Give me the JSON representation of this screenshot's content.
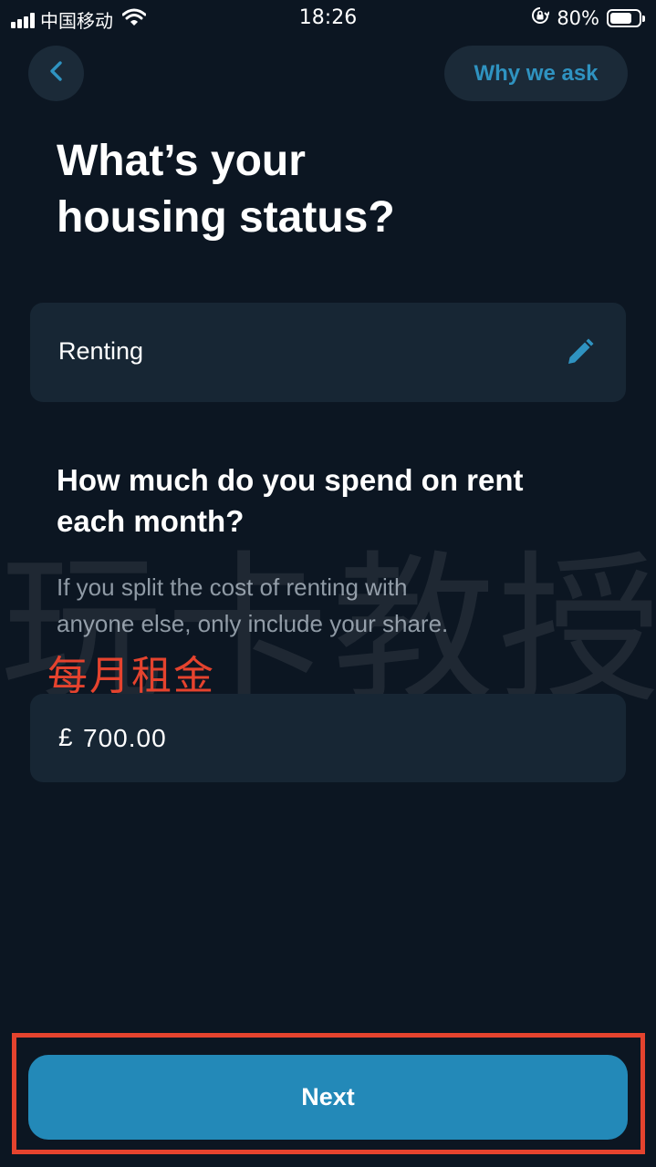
{
  "status_bar": {
    "carrier": "中国移动",
    "time": "18:26",
    "battery": "80%",
    "battery_level": 0.8
  },
  "nav": {
    "back_icon": "chevron-left-icon",
    "why_label": "Why we ask"
  },
  "page": {
    "title_line1": "What’s your",
    "title_line2": "housing status?"
  },
  "housing_status": {
    "value": "Renting",
    "edit_icon": "pencil-icon"
  },
  "rent_question": {
    "line1": "How much do you spend on rent",
    "line2": "each month?",
    "hint_line1": "If you split the cost of renting with",
    "hint_line2": "anyone else, only include your share."
  },
  "annotation": {
    "text": "每月租金",
    "color": "#e5432e"
  },
  "watermark": {
    "text": "玩卡教授"
  },
  "rent_amount": {
    "currency": "£",
    "value": "700.00"
  },
  "footer": {
    "next_label": "Next"
  },
  "colors": {
    "background": "#0c1622",
    "card": "#172634",
    "accent": "#2f93c1",
    "button": "#2389b8",
    "highlight": "#e5432e"
  }
}
